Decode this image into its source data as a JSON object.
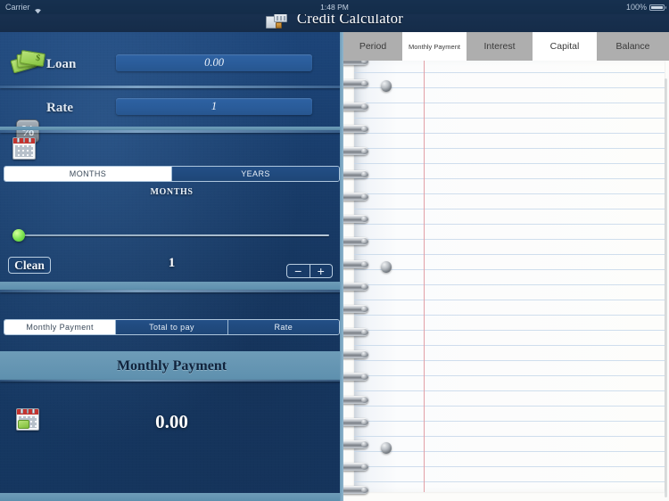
{
  "statusbar": {
    "carrier": "Carrier",
    "wifi_icon": "wifi-icon",
    "time": "1:48 PM",
    "battery_pct": "100%",
    "battery_icon": "battery-full-icon"
  },
  "header": {
    "title": "Credit Calculator",
    "icon": "cash-register-icon"
  },
  "left_panel": {
    "loan": {
      "icon": "money-icon",
      "label": "Loan",
      "value": "0.00",
      "placeholder": "0.00"
    },
    "rate": {
      "icon": "percent-icon",
      "label": "Rate",
      "value": "1",
      "placeholder": "1"
    },
    "period": {
      "icon": "calendar-icon",
      "segments": [
        {
          "label": "MONTHS",
          "selected": true
        },
        {
          "label": "YEARS",
          "selected": false
        }
      ],
      "slider_label": "MONTHS",
      "slider_value": 0,
      "slider_min": 0,
      "slider_max": 100,
      "clean_label": "Clean",
      "count_value": "1",
      "stepper_minus": "−",
      "stepper_plus": "+"
    },
    "result_tabs": [
      {
        "label": "Monthly Payment",
        "selected": true
      },
      {
        "label": "Total to pay",
        "selected": false
      },
      {
        "label": "Rate",
        "selected": false
      }
    ],
    "result": {
      "title": "Monthly Payment",
      "icon": "calendar-money-icon",
      "value": "0.00"
    }
  },
  "right_panel": {
    "tabs": [
      {
        "label": "Period",
        "selected": false
      },
      {
        "label": "Monthly Payment",
        "selected": true
      },
      {
        "label": "Interest",
        "selected": false
      },
      {
        "label": "Capital",
        "selected": true
      },
      {
        "label": "Balance",
        "selected": false
      }
    ],
    "paper": {
      "style": "spiral-notebook-ruled",
      "rows": []
    }
  },
  "colors": {
    "panel_blue": "#173a66",
    "band_blue": "#6e9cb8",
    "accent_green": "#79e24f",
    "tab_grey": "#aeaeae",
    "tab_active": "#ffffff",
    "rule_line": "#c7d8ea",
    "margin_line": "#e2a0a6"
  }
}
